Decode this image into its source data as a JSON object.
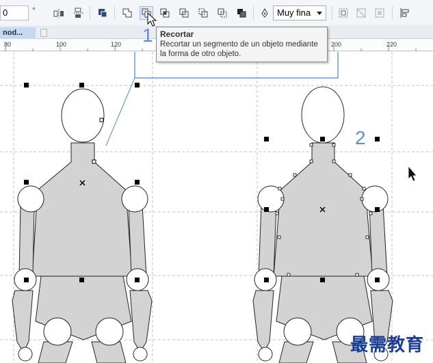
{
  "toolbar": {
    "rotation_value": "0",
    "rotation_unit": "°",
    "outline_width": "Muy fina"
  },
  "document_tab": {
    "label": "nod..."
  },
  "ruler": {
    "ticks": [
      "80",
      "100",
      "120",
      "200",
      "220"
    ]
  },
  "tooltip": {
    "title": "Recortar",
    "line1": "Recortar un segmento de un objeto mediante",
    "line2": "la forma de otro objeto."
  },
  "annotations": {
    "step1": "1",
    "step2": "2"
  },
  "watermark": "最需教育",
  "colors": {
    "accent": "#5b8fd6",
    "figure_fill": "#d3d3d3",
    "highlight_box": "#6b9bd8"
  }
}
